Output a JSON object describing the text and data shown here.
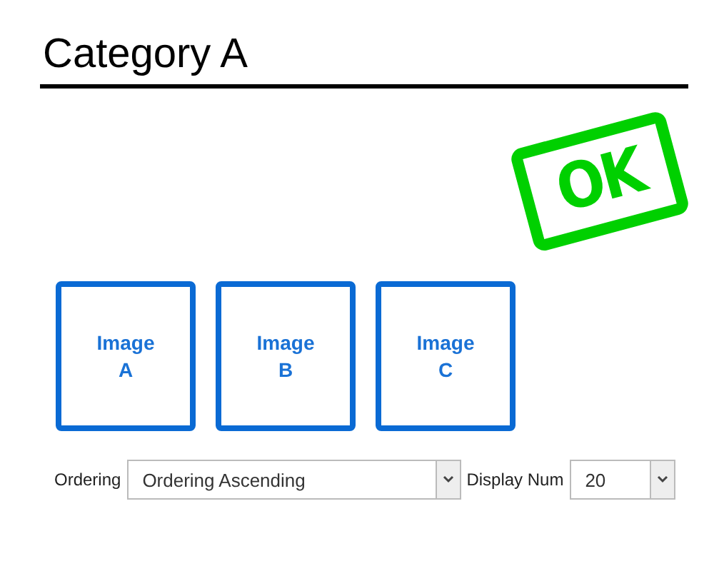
{
  "heading": "Category A",
  "stamp": {
    "text": "OK"
  },
  "images": [
    {
      "label": "Image\nA"
    },
    {
      "label": "Image\nB"
    },
    {
      "label": "Image\nC"
    }
  ],
  "controls": [
    {
      "label": "Ordering",
      "value": "Ordering Ascending",
      "kind": "wide"
    },
    {
      "label": "Display Num",
      "value": "20",
      "kind": "narrow"
    }
  ]
}
